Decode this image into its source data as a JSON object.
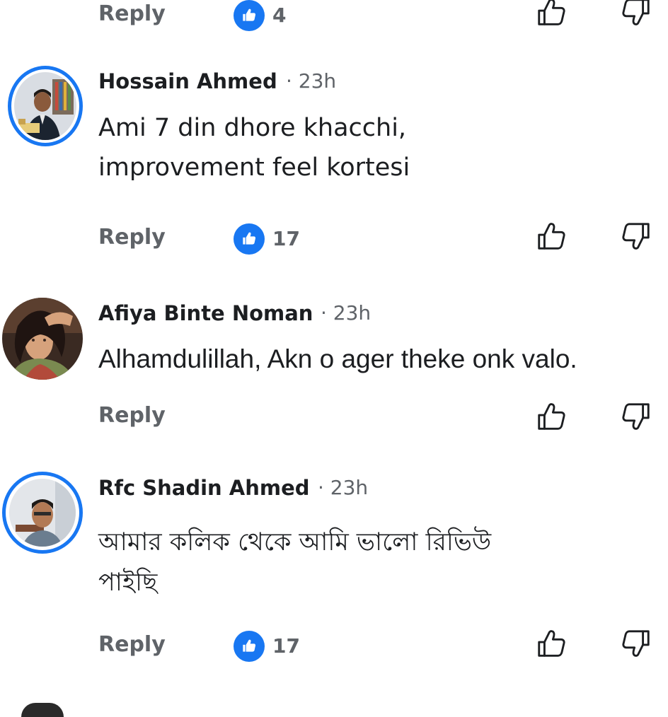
{
  "labels": {
    "reply": "Reply"
  },
  "colors": {
    "accent": "#1877f2",
    "secondary_text": "#5f6368",
    "primary_text": "#1c1e21"
  },
  "top_row": {
    "like_count": "4"
  },
  "comments": [
    {
      "author": "Hossain Ahmed",
      "time": "· 23h",
      "text_line1": "Ami 7 din dhore khacchi,",
      "text_line2": "improvement feel kortesi",
      "like_count": "17"
    },
    {
      "author": "Afiya Binte Noman",
      "time": "· 23h",
      "text_line1": "Alhamdulillah, Akn o ager theke onk valo."
    },
    {
      "author": "Rfc Shadin Ahmed",
      "time": "· 23h",
      "text_line1": "আমার কলিক থেকে আমি ভালো রিভিউ",
      "text_line2": "পাইছি",
      "like_count": "17"
    }
  ],
  "icons": [
    "like-badge-icon",
    "thumbs-up-icon",
    "thumbs-down-icon",
    "avatar"
  ]
}
